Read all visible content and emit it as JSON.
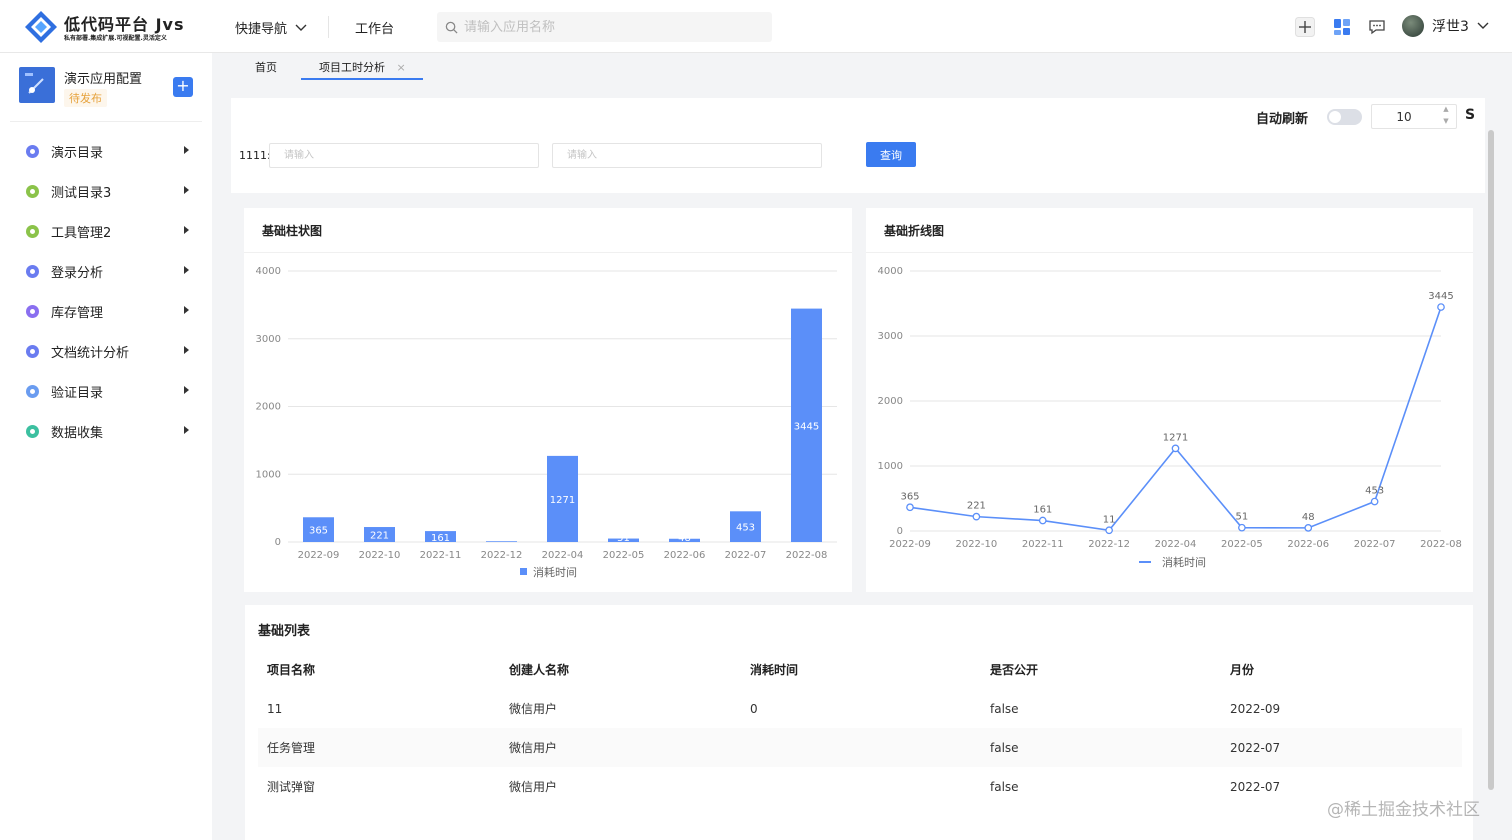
{
  "header": {
    "brand_title": "低代码平台 Jvs",
    "brand_subtitle": "私有部署.集成扩展.可视配置.灵活定义",
    "quick_nav": "快捷导航",
    "workbench": "工作台",
    "search_placeholder": "请输入应用名称",
    "user_name": "浮世3",
    "icons": [
      "plus-icon",
      "apps-grid-icon",
      "message-icon",
      "chevron-down-icon"
    ],
    "accent_color": "#3a7bf0"
  },
  "sidebar": {
    "app_name": "演示应用配置",
    "app_status": "待发布",
    "items": [
      {
        "label": "演示目录",
        "color": "#6a7cf0"
      },
      {
        "label": "测试目录3",
        "color": "#8bc34a"
      },
      {
        "label": "工具管理2",
        "color": "#8bc34a"
      },
      {
        "label": "登录分析",
        "color": "#6a7cf0"
      },
      {
        "label": "库存管理",
        "color": "#8a6ff0"
      },
      {
        "label": "文档统计分析",
        "color": "#6a7cf0"
      },
      {
        "label": "验证目录",
        "color": "#6a9cf0"
      },
      {
        "label": "数据收集",
        "color": "#3cc0a0"
      }
    ]
  },
  "tabs": [
    {
      "label": "首页"
    },
    {
      "label": "项目工时分析",
      "close": "×"
    }
  ],
  "filter": {
    "auto_refresh_label": "自动刷新",
    "interval_value": "10",
    "unit": "S",
    "field_label": "1111:",
    "input1_placeholder": "请输入",
    "input2_placeholder": "请输入",
    "query_button": "查询"
  },
  "bar_card": {
    "title": "基础柱状图"
  },
  "line_card": {
    "title": "基础折线图"
  },
  "chart_data": [
    {
      "type": "bar",
      "title": "基础柱状图",
      "categories": [
        "2022-09",
        "2022-10",
        "2022-11",
        "2022-12",
        "2022-04",
        "2022-05",
        "2022-06",
        "2022-07",
        "2022-08"
      ],
      "series": [
        {
          "name": "消耗时间",
          "values": [
            365,
            221,
            161,
            11,
            1271,
            51,
            48,
            453,
            3445
          ],
          "color": "#5b8ff9"
        }
      ],
      "yticks": [
        "0",
        "1000",
        "2000",
        "3000",
        "4000"
      ],
      "ylim": [
        0,
        4000
      ],
      "grid": true,
      "legend": "bottom"
    },
    {
      "type": "line",
      "title": "基础折线图",
      "categories": [
        "2022-09",
        "2022-10",
        "2022-11",
        "2022-12",
        "2022-04",
        "2022-05",
        "2022-06",
        "2022-07",
        "2022-08"
      ],
      "series": [
        {
          "name": "消耗时间",
          "values": [
            365,
            221,
            161,
            11,
            1271,
            51,
            48,
            453,
            3445
          ],
          "color": "#5b8ff9"
        }
      ],
      "yticks": [
        "0",
        "1000",
        "2000",
        "3000",
        "4000"
      ],
      "ylim": [
        0,
        4000
      ],
      "grid": true,
      "legend": "bottom"
    }
  ],
  "table": {
    "title": "基础列表",
    "columns": [
      "项目名称",
      "创建人名称",
      "消耗时间",
      "是否公开",
      "月份"
    ],
    "rows": [
      [
        "11",
        "微信用户",
        "0",
        "false",
        "2022-09"
      ],
      [
        "任务管理",
        "微信用户",
        "",
        "false",
        "2022-07"
      ],
      [
        "测试弹窗",
        "微信用户",
        "",
        "false",
        "2022-07"
      ]
    ]
  },
  "watermark": "@稀土掘金技术社区"
}
